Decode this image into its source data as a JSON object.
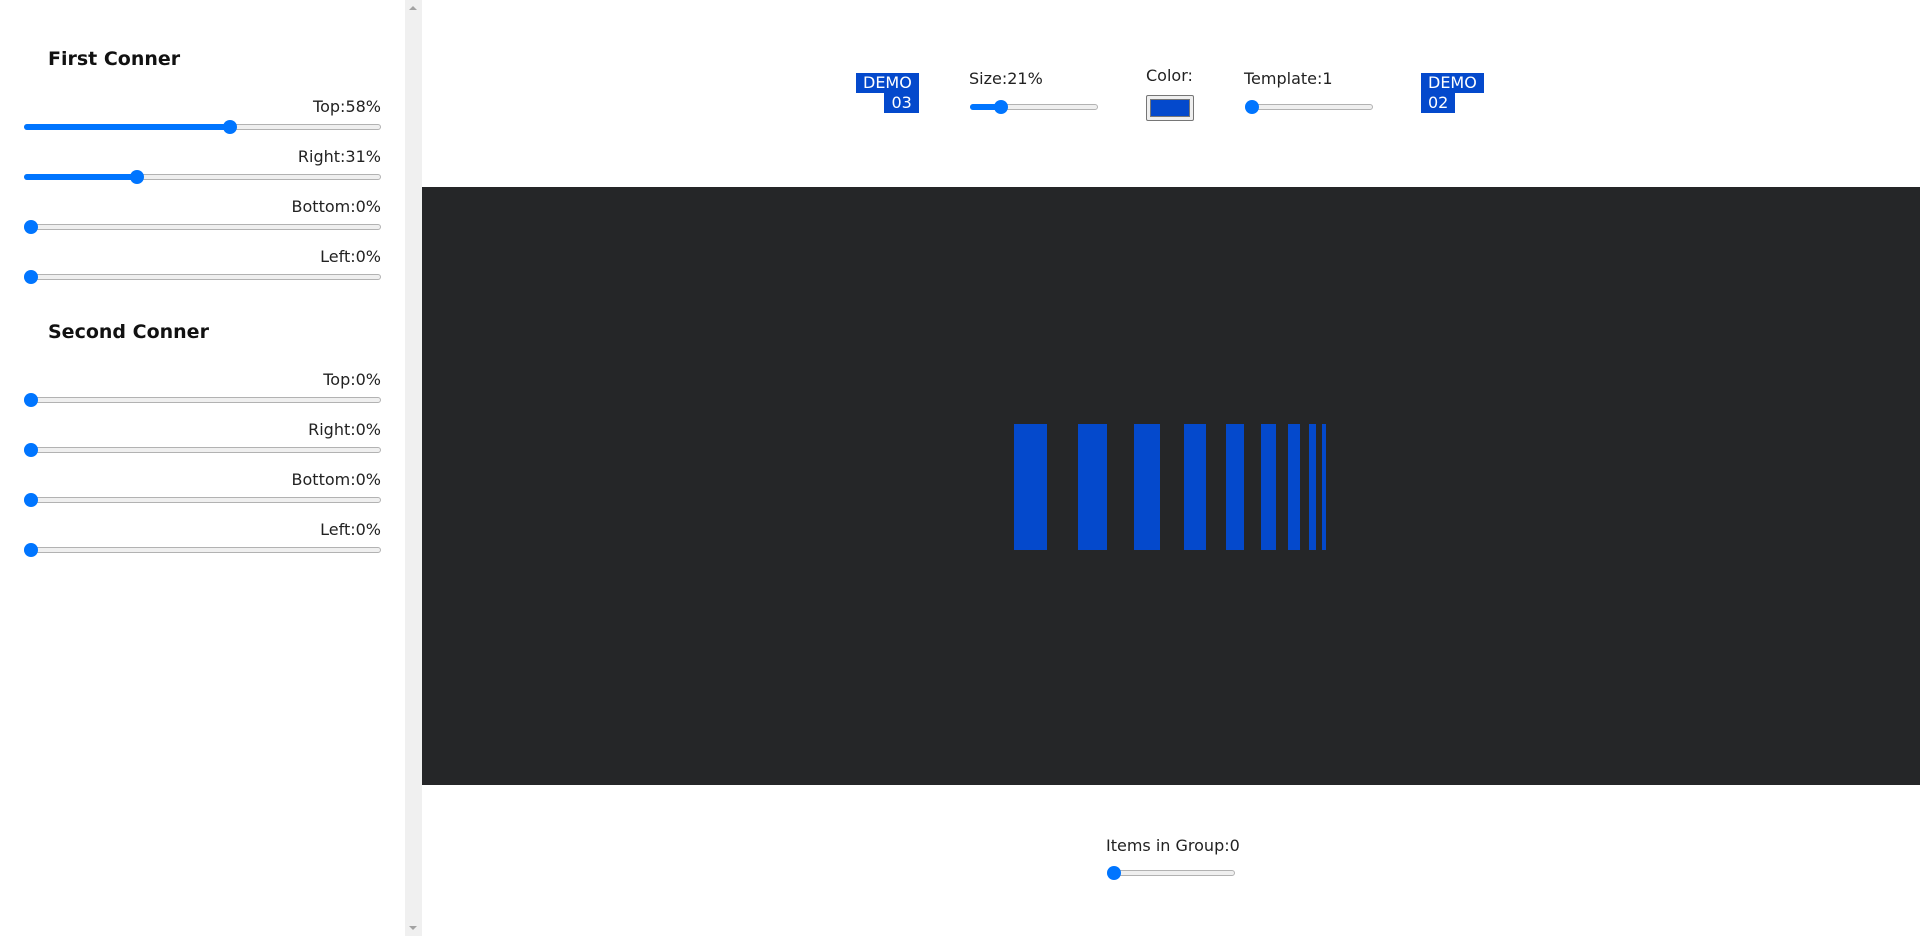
{
  "sidebar": {
    "first_corner": {
      "title": "First Conner",
      "sliders": [
        {
          "label": "Top:58%",
          "value": 58
        },
        {
          "label": "Right:31%",
          "value": 31
        },
        {
          "label": "Bottom:0%",
          "value": 0
        },
        {
          "label": "Left:0%",
          "value": 0
        }
      ]
    },
    "second_corner": {
      "title": "Second Conner",
      "sliders": [
        {
          "label": "Top:0%",
          "value": 0
        },
        {
          "label": "Right:0%",
          "value": 0
        },
        {
          "label": "Bottom:0%",
          "value": 0
        },
        {
          "label": "Left:0%",
          "value": 0
        }
      ]
    }
  },
  "toolbar": {
    "demo_prev": {
      "line1": "DEMO",
      "line2": "03"
    },
    "size": {
      "label": "Size:21%",
      "value": 21
    },
    "color": {
      "label": "Color:",
      "value": "#0449cc"
    },
    "template": {
      "label": "Template:1",
      "value": 0
    },
    "demo_next": {
      "line1": "DEMO",
      "line2": "02"
    }
  },
  "stage": {
    "background": "#252628",
    "bar_color": "#0449cc",
    "bar_count": 9
  },
  "footer": {
    "items_in_group": {
      "label": "Items in Group:0",
      "value": 0
    }
  }
}
